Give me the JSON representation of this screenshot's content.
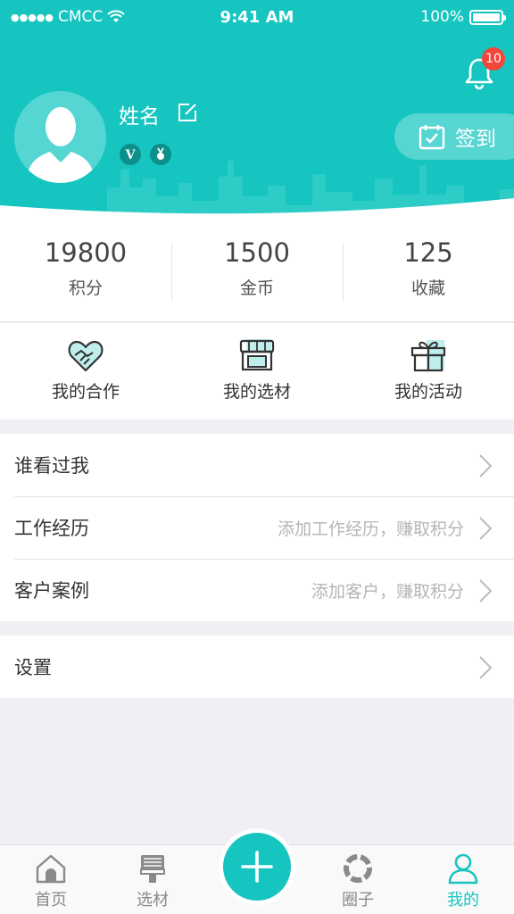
{
  "status_bar": {
    "signal_dots": "●●●●●",
    "carrier": "CMCC",
    "time": "9:41 AM",
    "battery": "100%"
  },
  "header": {
    "notification_count": "10",
    "user_name": "姓名",
    "badge_v": "V",
    "signin_label": "签到"
  },
  "stats": [
    {
      "value": "19800",
      "label": "积分"
    },
    {
      "value": "1500",
      "label": "金币"
    },
    {
      "value": "125",
      "label": "收藏"
    }
  ],
  "quick_actions": [
    {
      "label": "我的合作",
      "icon": "handshake-icon"
    },
    {
      "label": "我的选材",
      "icon": "storefront-icon"
    },
    {
      "label": "我的活动",
      "icon": "gift-icon"
    }
  ],
  "list_items": [
    {
      "label": "谁看过我",
      "hint": ""
    },
    {
      "label": "工作经历",
      "hint": "添加工作经历，赚取积分"
    },
    {
      "label": "客户案例",
      "hint": "添加客户，赚取积分"
    }
  ],
  "settings": {
    "label": "设置"
  },
  "tabbar": {
    "tabs": [
      {
        "label": "首页",
        "icon": "home-icon"
      },
      {
        "label": "选材",
        "icon": "paint-brush-icon"
      },
      {
        "label": "圈子",
        "icon": "circle-icon"
      },
      {
        "label": "我的",
        "icon": "profile-icon"
      }
    ],
    "active_index": 3
  },
  "colors": {
    "primary": "#17c5c0",
    "badge_red": "#f0463b",
    "background": "#efeff4"
  }
}
